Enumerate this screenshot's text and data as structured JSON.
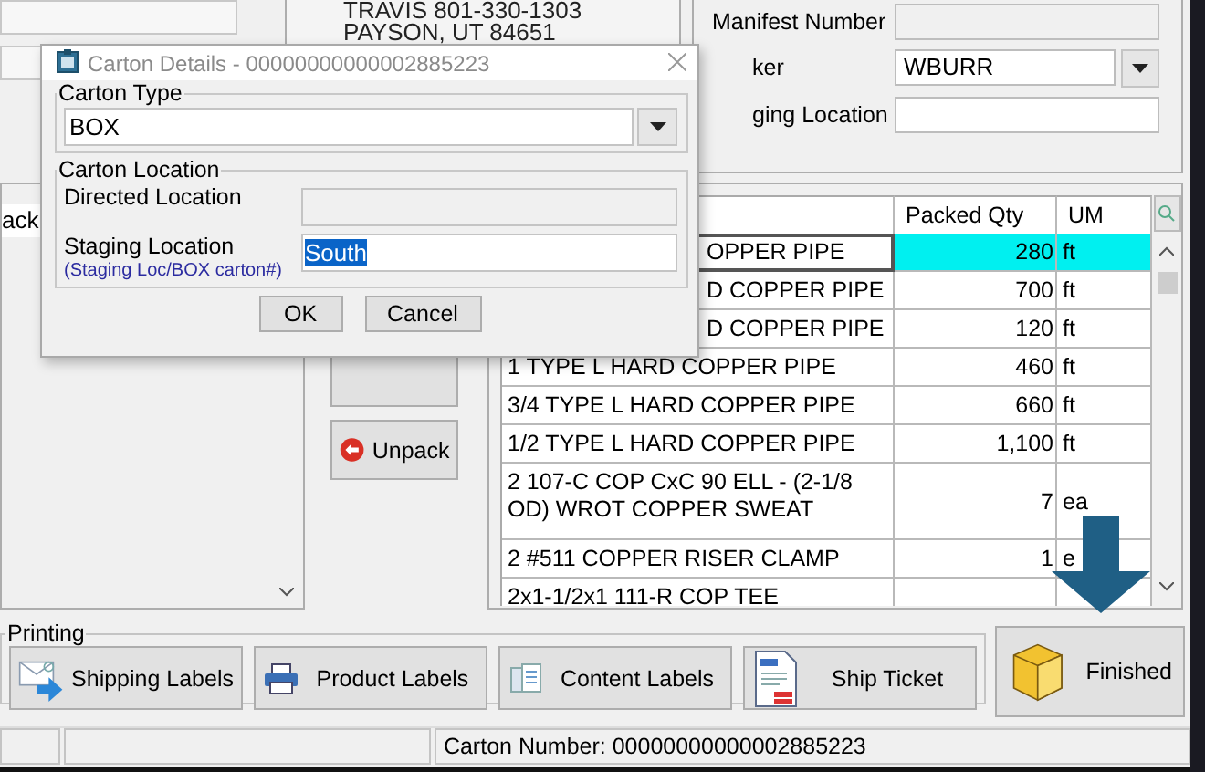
{
  "address": {
    "line_1": "TRAVIS 801-330-1303",
    "line_2": "PAYSON, UT 84651"
  },
  "manifest": {
    "label": "Manifest Number",
    "disabled": true
  },
  "picker": {
    "label": "ker",
    "value": "WBURR"
  },
  "staging": {
    "label": "ging Location"
  },
  "pack_tab": {
    "label": "ack"
  },
  "unpack_button": {
    "label": "Unpack"
  },
  "table": {
    "columns": [
      "Packed Qty",
      "UM"
    ],
    "rows": [
      {
        "description": "OPPER PIPE",
        "packed_qty": "280",
        "um": "ft",
        "selected": true
      },
      {
        "description": "D COPPER PIPE",
        "packed_qty": "700",
        "um": "ft",
        "selected": false
      },
      {
        "description": "D COPPER PIPE",
        "packed_qty": "120",
        "um": "ft",
        "selected": false
      },
      {
        "description": "1 TYPE L HARD COPPER PIPE",
        "packed_qty": "460",
        "um": "ft",
        "selected": false
      },
      {
        "description": "3/4 TYPE L HARD COPPER PIPE",
        "packed_qty": "660",
        "um": "ft",
        "selected": false
      },
      {
        "description": "1/2 TYPE L HARD COPPER PIPE",
        "packed_qty": "1,100",
        "um": "ft",
        "selected": false
      },
      {
        "description": "2 107-C COP CxC 90 ELL - (2-1/8 OD) WROT COPPER SWEAT",
        "packed_qty": "7",
        "um": "ea",
        "selected": false
      },
      {
        "description": "2 #511 COPPER RISER CLAMP",
        "packed_qty": "1",
        "um": "e",
        "selected": false
      },
      {
        "description": "2x1-1/2x1 111-R COP TEE",
        "selected": false
      }
    ]
  },
  "printing": {
    "title": "Printing",
    "buttons": [
      {
        "label": "Shipping Labels",
        "kind": "shipping"
      },
      {
        "label": "Product Labels",
        "kind": "product"
      },
      {
        "label": "Content Labels",
        "kind": "content"
      },
      {
        "label": "Ship Ticket",
        "kind": "ticket"
      }
    ]
  },
  "finished_button": {
    "label": "Finished"
  },
  "status_bar": {
    "carton_number": "Carton Number: 00000000000002885223"
  },
  "dialog": {
    "title": "Carton Details - 00000000000002885223",
    "carton_type": {
      "legend": "Carton Type",
      "value": "BOX"
    },
    "carton_location": {
      "legend": "Carton Location",
      "directed": {
        "label": "Directed Location",
        "disabled": true
      },
      "staging": {
        "label": "Staging Location",
        "hint": "(Staging Loc/BOX carton#)",
        "value": "South",
        "selected": true
      }
    },
    "buttons": [
      "OK",
      "Cancel"
    ]
  }
}
